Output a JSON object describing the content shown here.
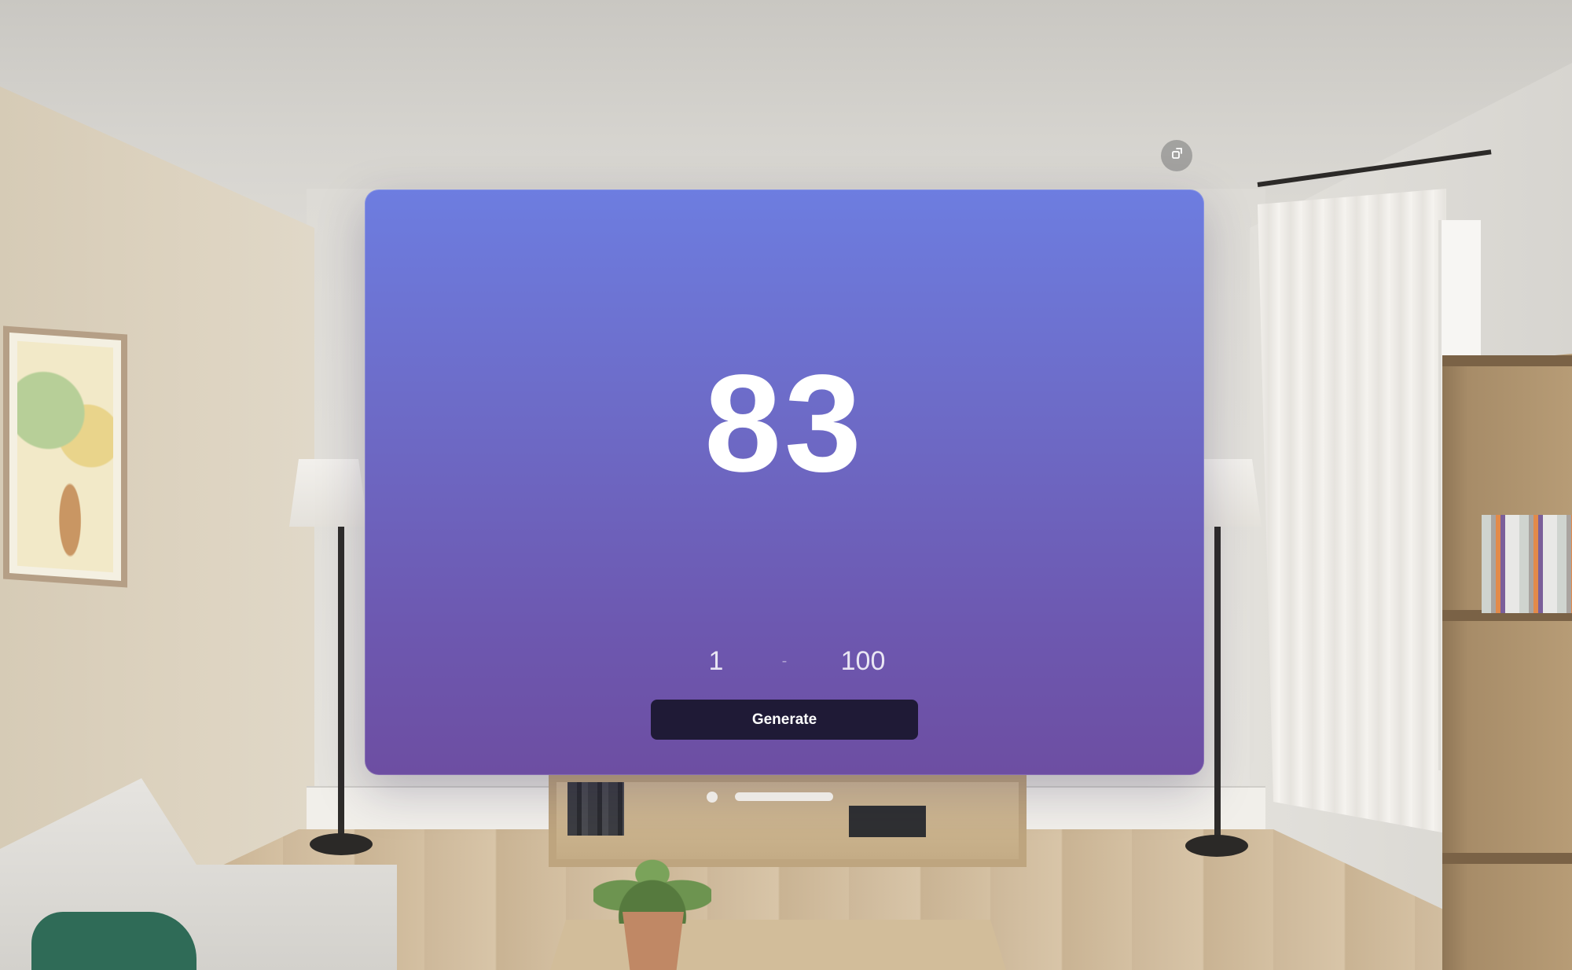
{
  "app": {
    "result": "83",
    "range": {
      "min": "1",
      "separator": "-",
      "max": "100"
    },
    "generate_label": "Generate"
  },
  "window_chrome": {
    "icons": [
      "resize-icon",
      "close-dot-icon",
      "move-handle-icon"
    ]
  },
  "colors": {
    "window_top": "#6d7de0",
    "window_bottom": "#6d4ea2",
    "button_bg": "#1f1a36",
    "text": "#ffffff"
  }
}
